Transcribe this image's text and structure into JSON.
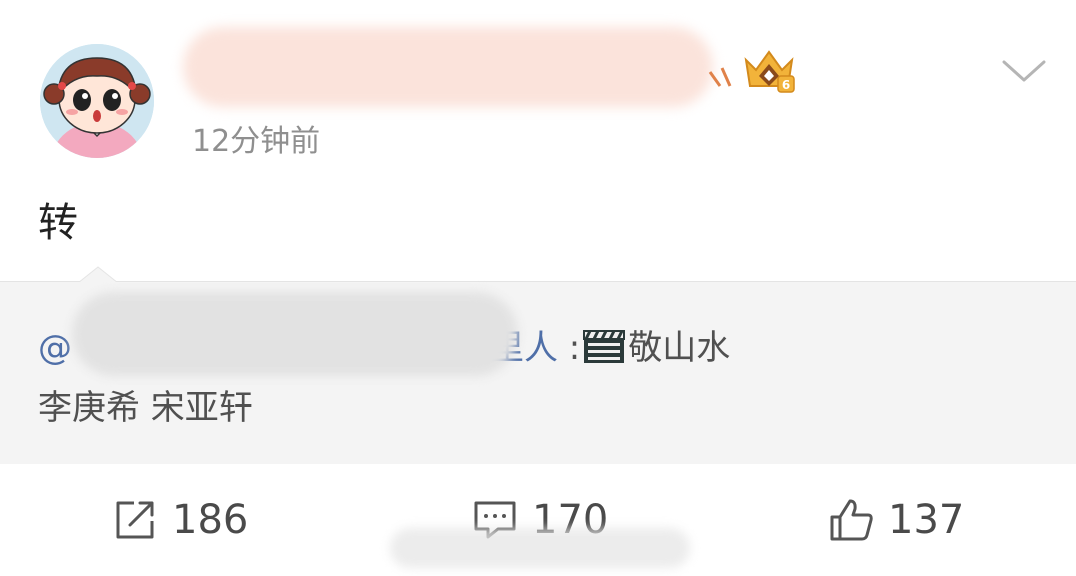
{
  "post": {
    "timestamp": "12分钟前",
    "text": "转",
    "badge_level": "6",
    "icons": {
      "menu": "chevron-down-icon",
      "badge": "crown-badge-icon"
    }
  },
  "repost": {
    "mention_prefix": "@",
    "mention_suffix": "里人",
    "separator": " :",
    "emoji": "clapperboard-icon",
    "title": "敬山水",
    "line2": "李庚希 宋亚轩"
  },
  "actions": {
    "repost_count": "186",
    "comment_count": "170",
    "like_count": "137"
  },
  "colors": {
    "link": "#4f6fa8",
    "muted": "#8f8f8f",
    "repost_bg": "#f4f4f4"
  }
}
